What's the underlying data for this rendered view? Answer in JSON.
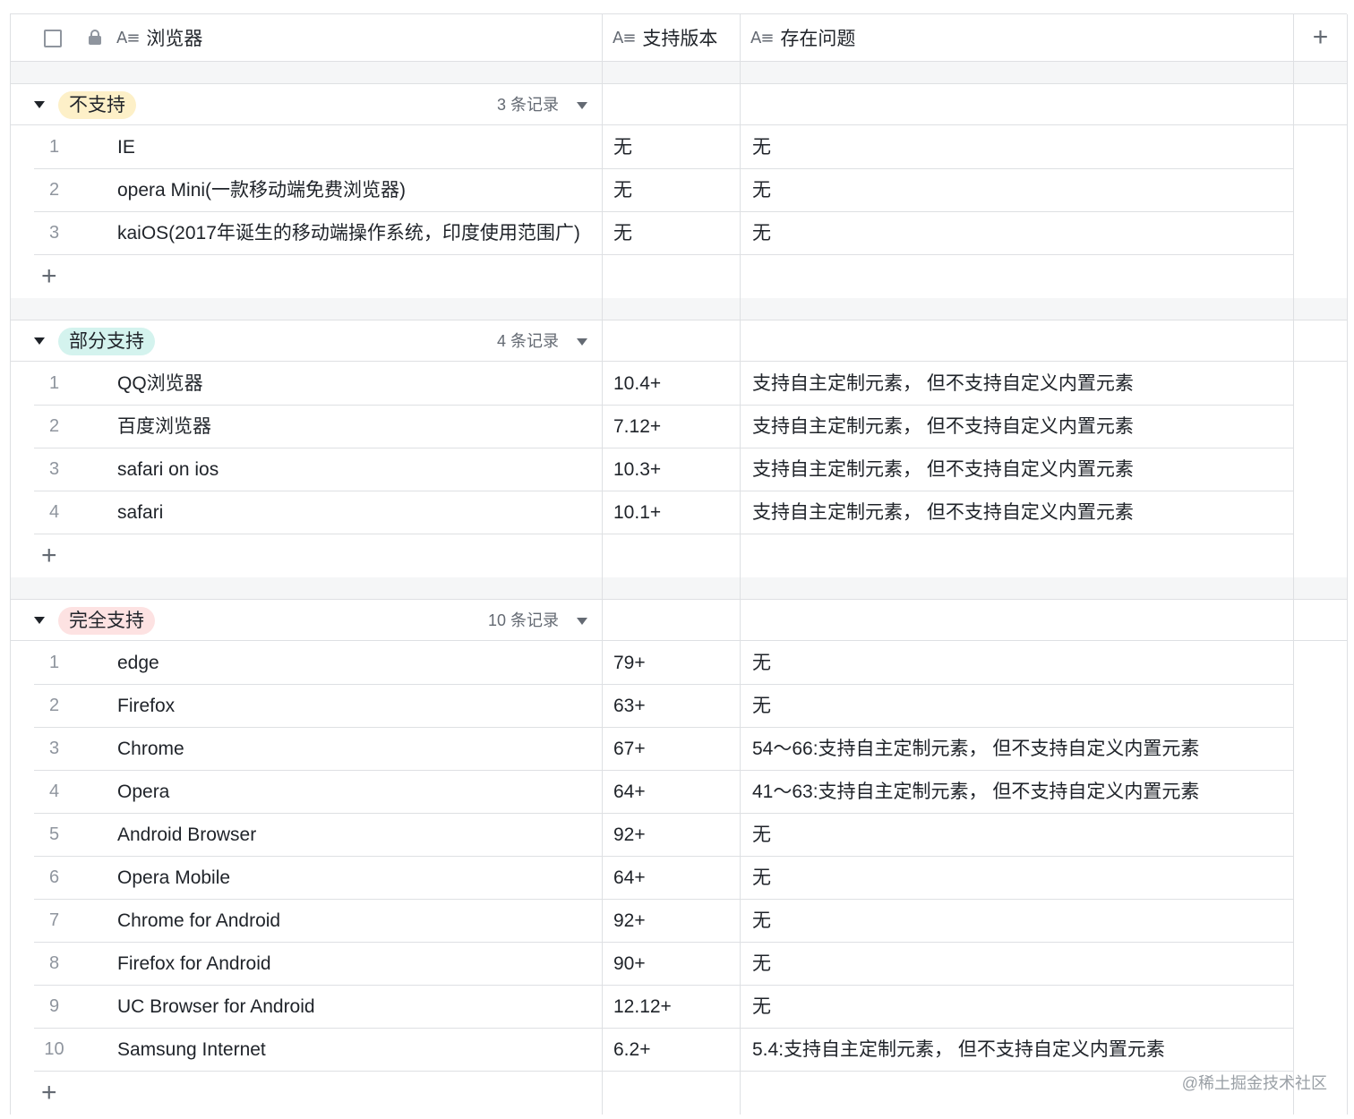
{
  "header": {
    "col_browser": "浏览器",
    "col_version": "支持版本",
    "col_issue": "存在问题",
    "field_icon": "text-field-icon",
    "add_column": "+"
  },
  "groups": [
    {
      "tag": "不支持",
      "tag_color": "#fdf0c8",
      "count": "3 条记录",
      "rows": [
        {
          "num": "1",
          "browser": "IE",
          "version": "无",
          "issue": "无"
        },
        {
          "num": "2",
          "browser": "opera Mini(一款移动端免费浏览器)",
          "version": "无",
          "issue": "无"
        },
        {
          "num": "3",
          "browser": "kaiOS(2017年诞生的移动端操作系统，印度使用范围广)",
          "version": "无",
          "issue": "无"
        }
      ],
      "add": "+"
    },
    {
      "tag": "部分支持",
      "tag_color": "#d4f3ee",
      "count": "4 条记录",
      "rows": [
        {
          "num": "1",
          "browser": "QQ浏览器",
          "version": "10.4+",
          "issue": "支持自主定制元素， 但不支持自定义内置元素"
        },
        {
          "num": "2",
          "browser": "百度浏览器",
          "version": "7.12+",
          "issue": "支持自主定制元素， 但不支持自定义内置元素"
        },
        {
          "num": "3",
          "browser": "safari on ios",
          "version": "10.3+",
          "issue": "支持自主定制元素， 但不支持自定义内置元素"
        },
        {
          "num": "4",
          "browser": "safari",
          "version": "10.1+",
          "issue": "支持自主定制元素， 但不支持自定义内置元素"
        }
      ],
      "add": "+"
    },
    {
      "tag": "完全支持",
      "tag_color": "#fde2e2",
      "count": "10 条记录",
      "rows": [
        {
          "num": "1",
          "browser": "edge",
          "version": "79+",
          "issue": "无"
        },
        {
          "num": "2",
          "browser": "Firefox",
          "version": "63+",
          "issue": "无"
        },
        {
          "num": "3",
          "browser": "Chrome",
          "version": "67+",
          "issue": "54～66:支持自主定制元素， 但不支持自定义内置元素"
        },
        {
          "num": "4",
          "browser": "Opera",
          "version": "64+",
          "issue": "41～63:支持自主定制元素， 但不支持自定义内置元素"
        },
        {
          "num": "5",
          "browser": "Android Browser",
          "version": "92+",
          "issue": "无"
        },
        {
          "num": "6",
          "browser": "Opera Mobile",
          "version": "64+",
          "issue": "无"
        },
        {
          "num": "7",
          "browser": "Chrome for Android",
          "version": "92+",
          "issue": "无"
        },
        {
          "num": "8",
          "browser": "Firefox for Android",
          "version": "90+",
          "issue": "无"
        },
        {
          "num": "9",
          "browser": "UC Browser for Android",
          "version": "12.12+",
          "issue": "无"
        },
        {
          "num": "10",
          "browser": "Samsung Internet",
          "version": "6.2+",
          "issue": "5.4:支持自主定制元素， 但不支持自定义内置元素"
        }
      ],
      "add": "+"
    }
  ],
  "watermark": "@稀土掘金技术社区"
}
